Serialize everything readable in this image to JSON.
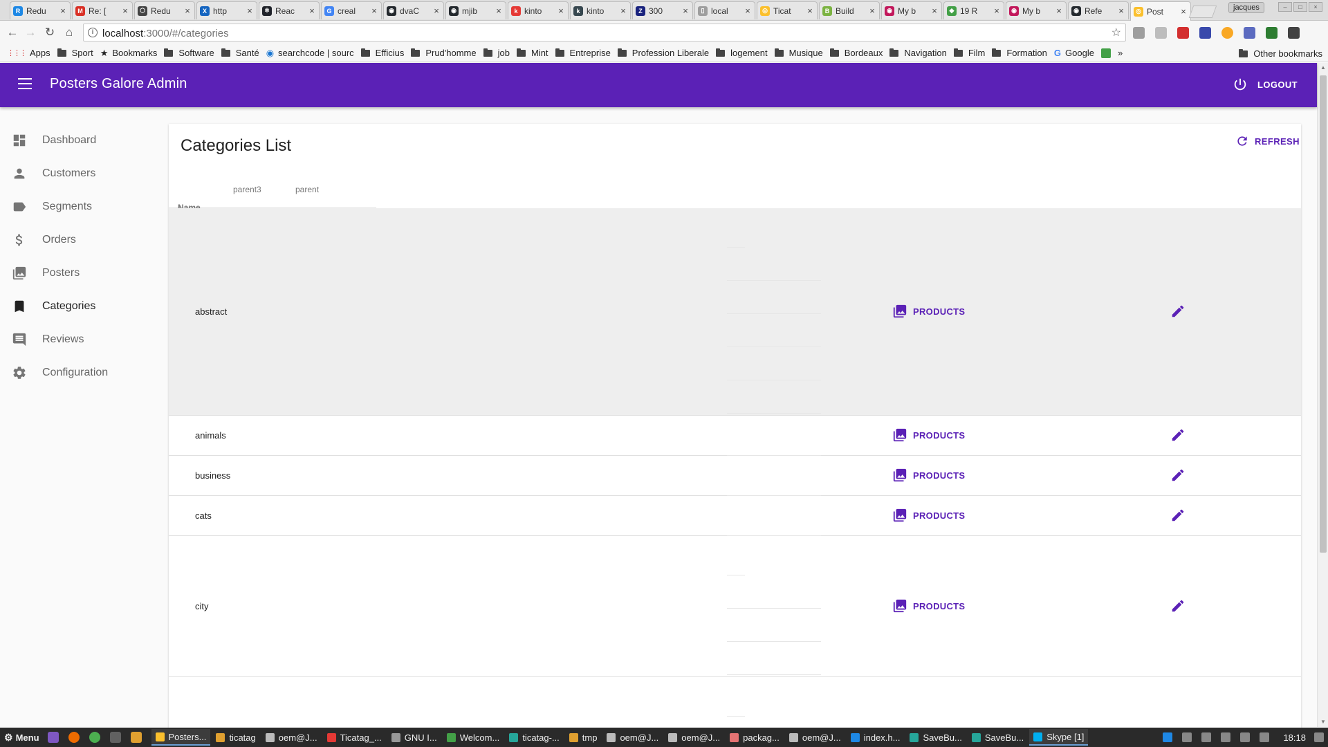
{
  "browser": {
    "tabs": [
      {
        "label": "Redu",
        "color": "#1e88e5",
        "glyph": "R"
      },
      {
        "label": "Re: [",
        "color": "#d93025",
        "glyph": "M"
      },
      {
        "label": "Redu",
        "color": "#444444",
        "glyph": "⬡"
      },
      {
        "label": "http",
        "color": "#1565c0",
        "glyph": "X"
      },
      {
        "label": "Reac",
        "color": "#20232a",
        "glyph": "⚛"
      },
      {
        "label": "creal",
        "color": "#4285f4",
        "glyph": "G"
      },
      {
        "label": "dvaC",
        "color": "#24292e",
        "glyph": "◉"
      },
      {
        "label": "mjib",
        "color": "#24292e",
        "glyph": "◉"
      },
      {
        "label": "kinto",
        "color": "#e53935",
        "glyph": "k"
      },
      {
        "label": "kinto",
        "color": "#37474f",
        "glyph": "k"
      },
      {
        "label": "300",
        "color": "#1a237e",
        "glyph": "Z"
      },
      {
        "label": "local",
        "color": "#9e9e9e",
        "glyph": "▯"
      },
      {
        "label": "Ticat",
        "color": "#fbc02d",
        "glyph": "◎"
      },
      {
        "label": "Build",
        "color": "#7cb342",
        "glyph": "B"
      },
      {
        "label": "My b",
        "color": "#c2185b",
        "glyph": "◉"
      },
      {
        "label": "19 R",
        "color": "#43a047",
        "glyph": "◆"
      },
      {
        "label": "My b",
        "color": "#c2185b",
        "glyph": "◉"
      },
      {
        "label": "Refe",
        "color": "#24292e",
        "glyph": "◉"
      },
      {
        "label": "Post",
        "color": "#fbc02d",
        "glyph": "◎",
        "active": true
      }
    ],
    "profile": "jacques",
    "url_host": "localhost",
    "url_path": ":3000/#/categories",
    "bookmarks": [
      "Apps",
      "Sport",
      "Bookmarks",
      "Software",
      "Santé",
      "searchcode | sourc",
      "Efficius",
      "Prud'homme",
      "job",
      "Mint",
      "Entreprise",
      "Profession Liberale",
      "logement",
      "Musique",
      "Bordeaux",
      "Navigation",
      "Film",
      "Formation",
      "Google"
    ],
    "bookmarks_overflow": "»",
    "other_bookmarks": "Other bookmarks"
  },
  "app": {
    "title": "Posters Galore Admin",
    "logout": "LOGOUT",
    "menu": [
      {
        "label": "Dashboard",
        "icon": "dashboard-icon"
      },
      {
        "label": "Customers",
        "icon": "person-icon"
      },
      {
        "label": "Segments",
        "icon": "label-icon"
      },
      {
        "label": "Orders",
        "icon": "dollar-icon"
      },
      {
        "label": "Posters",
        "icon": "collections-icon"
      },
      {
        "label": "Categories",
        "icon": "bookmark-icon",
        "active": true
      },
      {
        "label": "Reviews",
        "icon": "comment-icon"
      },
      {
        "label": "Configuration",
        "icon": "settings-icon"
      }
    ]
  },
  "list": {
    "title": "Categories List",
    "refresh": "REFRESH",
    "columns": [
      "Name",
      "parent3",
      "parent"
    ],
    "sorted_column": "Name",
    "products_label": "PRODUCTS",
    "rows": [
      {
        "name": "abstract"
      },
      {
        "name": "animals"
      },
      {
        "name": "business"
      },
      {
        "name": "cats"
      },
      {
        "name": "city"
      }
    ]
  },
  "taskbar": {
    "start": "Menu",
    "tasks": [
      {
        "label": "Posters...",
        "color": "#fbc02d",
        "active": true
      },
      {
        "label": "ticatag",
        "color": "#e0a030"
      },
      {
        "label": "oem@J...",
        "color": "#bbbbbb"
      },
      {
        "label": "Ticatag_...",
        "color": "#e53935"
      },
      {
        "label": "GNU I...",
        "color": "#999999"
      },
      {
        "label": "Welcom...",
        "color": "#43a047"
      },
      {
        "label": "ticatag-...",
        "color": "#26a69a"
      },
      {
        "label": "tmp",
        "color": "#e0a030"
      },
      {
        "label": "oem@J...",
        "color": "#bbbbbb"
      },
      {
        "label": "oem@J...",
        "color": "#bbbbbb"
      },
      {
        "label": "packag...",
        "color": "#e57373"
      },
      {
        "label": "oem@J...",
        "color": "#bbbbbb"
      },
      {
        "label": "index.h...",
        "color": "#1e88e5"
      },
      {
        "label": "SaveBu...",
        "color": "#26a69a"
      },
      {
        "label": "SaveBu...",
        "color": "#26a69a"
      },
      {
        "label": "Skype [1]",
        "color": "#00aff0",
        "active": true
      }
    ],
    "clock": "18:18"
  }
}
